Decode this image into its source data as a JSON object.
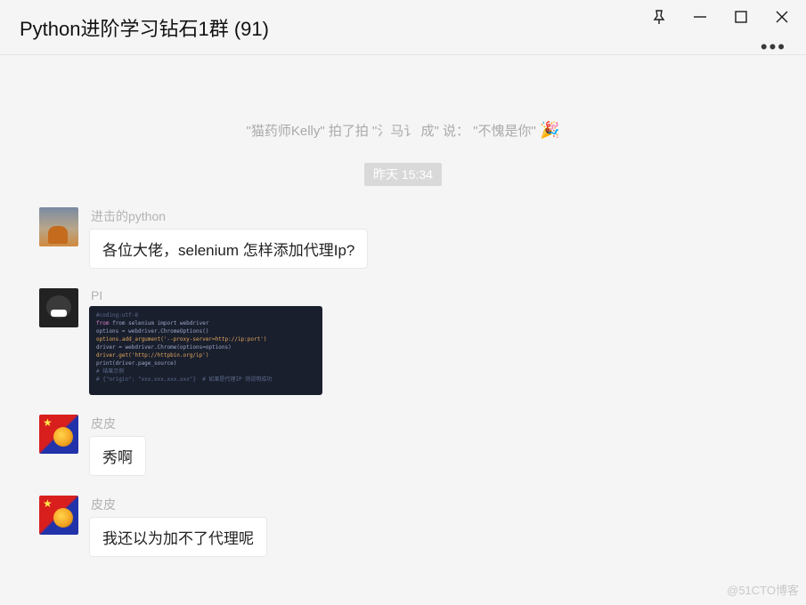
{
  "header": {
    "title": "Python进阶学习钻石1群 (91)"
  },
  "chat": {
    "system_notice": "\"猫药师Kelly\" 拍了拍 \"氵马讠 成\" 说：  \"不愧是你\"",
    "system_emoji": "🎉",
    "timestamp": "昨天 15:34",
    "messages": [
      {
        "sender": "进击的python",
        "avatar": "street",
        "type": "text",
        "text": "各位大佬，selenium 怎样添加代理Ip?"
      },
      {
        "sender": "PI",
        "avatar": "dark",
        "type": "code",
        "code_lines": [
          "#coding:utf-8",
          "from selenium import webdriver",
          "options = webdriver.ChromeOptions()",
          "options.add_argument('--proxy-server=http://ip:port')",
          "driver = webdriver.Chrome(options=options)",
          "driver.get('http://httpbin.org/ip')",
          "print(driver.page_source)",
          "# 结果示例",
          "# {\"origin\": \"xxx.xxx.xxx.xxx\"}  # 如果是代理IP 则说明成功"
        ]
      },
      {
        "sender": "皮皮",
        "avatar": "flag",
        "type": "text",
        "text": "秀啊"
      },
      {
        "sender": "皮皮",
        "avatar": "flag",
        "type": "text",
        "text": "我还以为加不了代理呢"
      }
    ]
  },
  "watermark": "@51CTO博客"
}
